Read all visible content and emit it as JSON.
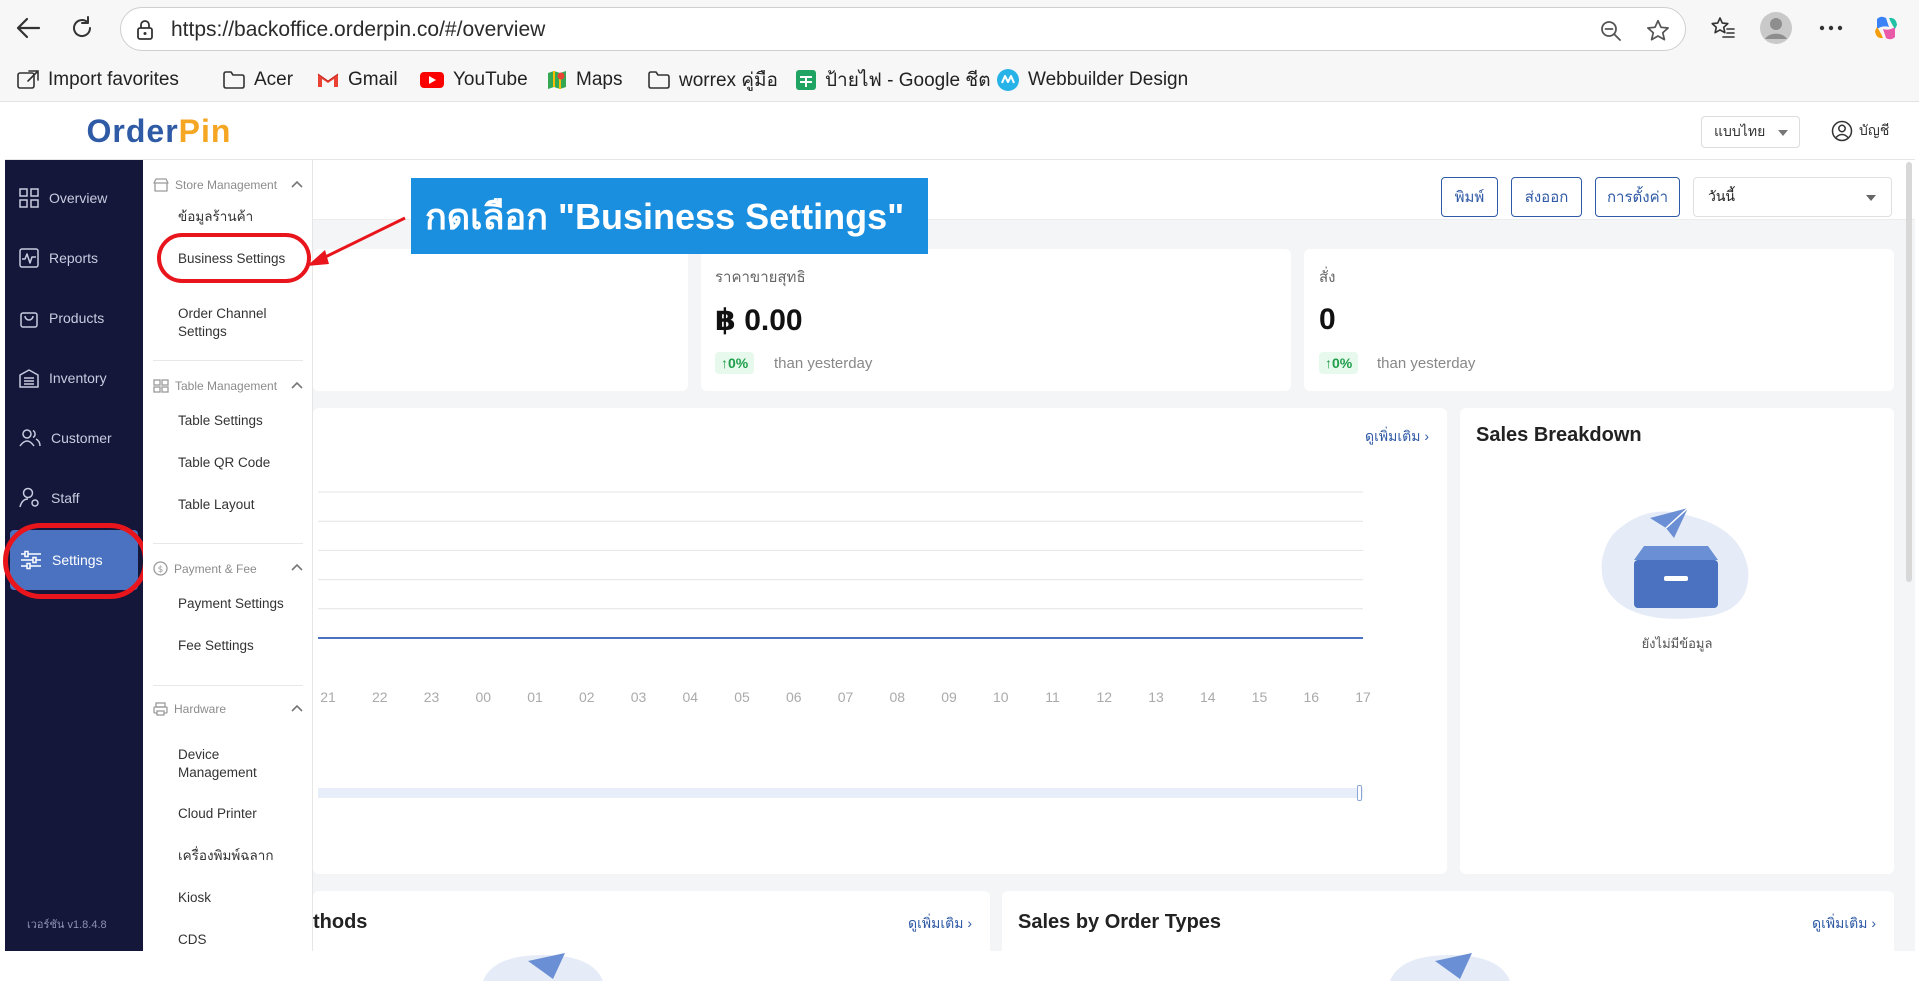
{
  "browser": {
    "url": "https://backoffice.orderpin.co/#/overview",
    "bookmarks": [
      {
        "label": "Import favorites",
        "icon": "import-icon"
      },
      {
        "label": "Acer",
        "icon": "folder-icon"
      },
      {
        "label": "Gmail",
        "icon": "gmail-icon"
      },
      {
        "label": "YouTube",
        "icon": "youtube-icon"
      },
      {
        "label": "Maps",
        "icon": "maps-icon"
      },
      {
        "label": "worrex คู่มือ",
        "icon": "folder-icon"
      },
      {
        "label": "ป้ายไฟ - Google ชีต",
        "icon": "sheets-icon"
      },
      {
        "label": "Webbuilder Design",
        "icon": "webbuilder-icon"
      }
    ]
  },
  "app": {
    "logo_part1": "Order",
    "logo_part2": "Pin",
    "language": "แบบไทย",
    "account": "บัญชี",
    "version": "เวอร์ชัน v1.8.4.8",
    "brand_colors": {
      "primary": "#2f5aa5",
      "accent": "#f5a623",
      "sidebar": "#15173a",
      "highlight": "#e8161c"
    }
  },
  "sidebar": {
    "items": [
      {
        "label": "Overview",
        "icon": "grid-icon"
      },
      {
        "label": "Reports",
        "icon": "chart-icon"
      },
      {
        "label": "Products",
        "icon": "bag-icon"
      },
      {
        "label": "Inventory",
        "icon": "warehouse-icon"
      },
      {
        "label": "Customer",
        "icon": "users-icon"
      },
      {
        "label": "Staff",
        "icon": "staff-icon"
      },
      {
        "label": "Settings",
        "icon": "sliders-icon",
        "active": true
      }
    ]
  },
  "submenu": {
    "sections": [
      {
        "title": "Store Management",
        "icon": "store-icon",
        "items": [
          "ข้อมูลร้านค้า",
          "Business Settings",
          "Order Channel Settings"
        ]
      },
      {
        "title": "Table Management",
        "icon": "table-icon",
        "items": [
          "Table Settings",
          "Table QR Code",
          "Table Layout"
        ]
      },
      {
        "title": "Payment & Fee",
        "icon": "coin-icon",
        "items": [
          "Payment Settings",
          "Fee Settings"
        ]
      },
      {
        "title": "Hardware",
        "icon": "printer-icon",
        "items": [
          "Device Management",
          "Cloud Printer",
          "เครื่องพิมพ์ฉลาก",
          "Kiosk",
          "CDS"
        ]
      }
    ]
  },
  "toolbar": {
    "print": "พิมพ์",
    "export": "ส่งออก",
    "settings": "การตั้งค่า",
    "date_filter": "วันนี้"
  },
  "annotation": {
    "callout": "กดเลือก \"Business Settings\""
  },
  "kpis": [
    {
      "label": "ราคาขายสุทธิ",
      "value": "฿ 0.00",
      "change": "↑0%",
      "than": "than yesterday"
    },
    {
      "label": "สั่ง",
      "value": "0",
      "change": "↑0%",
      "than": "than yesterday"
    }
  ],
  "sales_chart": {
    "more": "ดูเพิ่มเติม",
    "chart_data": {
      "type": "line",
      "x": [
        "21",
        "22",
        "23",
        "00",
        "01",
        "02",
        "03",
        "04",
        "05",
        "06",
        "07",
        "08",
        "09",
        "10",
        "11",
        "12",
        "13",
        "14",
        "15",
        "16",
        "17"
      ],
      "series": [
        {
          "values": [
            0,
            0,
            0,
            0,
            0,
            0,
            0,
            0,
            0,
            0,
            0,
            0,
            0,
            0,
            0,
            0,
            0,
            0,
            0,
            0,
            0
          ]
        }
      ],
      "grid": true
    }
  },
  "sales_breakdown": {
    "title": "Sales Breakdown",
    "empty": "ยังไม่มีข้อมูล"
  },
  "payment_methods": {
    "title_visible": "thods",
    "more": "ดูเพิ่มเติม"
  },
  "order_types": {
    "title": "Sales by Order Types",
    "more": "ดูเพิ่มเติม"
  }
}
